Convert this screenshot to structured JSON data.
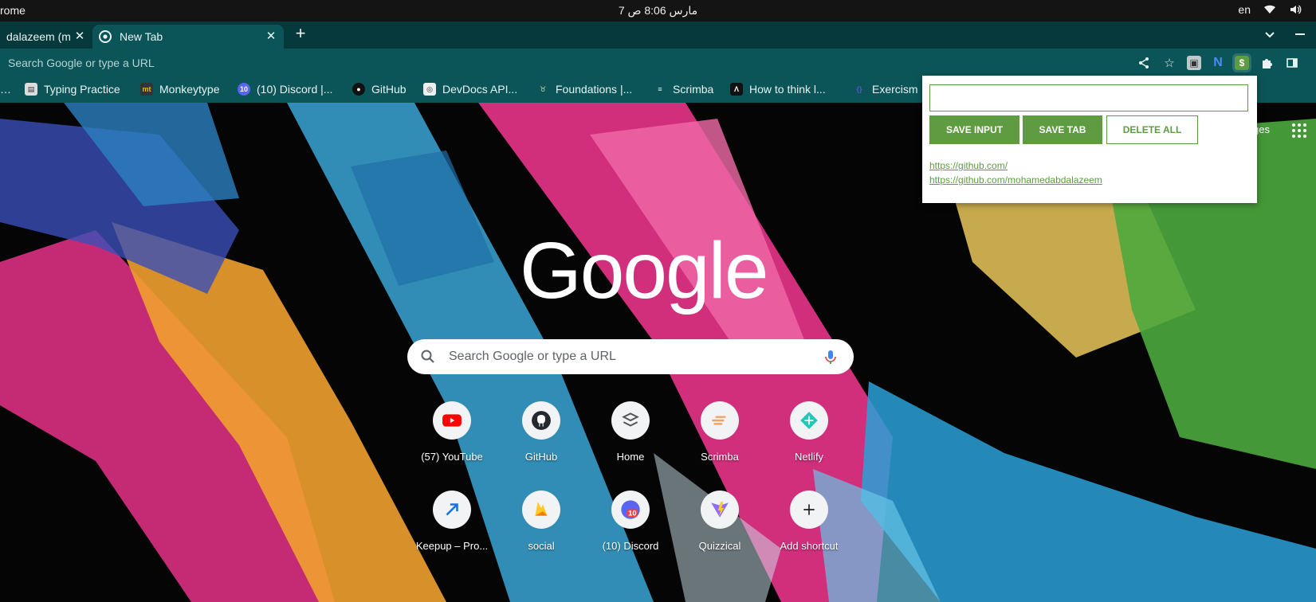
{
  "os": {
    "app_name": "rome",
    "clock": "7 مارس  8:06 ص",
    "lang": "en"
  },
  "tabs": [
    {
      "title": "dalazeem (m",
      "active": false
    },
    {
      "title": "New Tab",
      "active": true
    }
  ],
  "omnibox": {
    "placeholder": "Search Google or type a URL"
  },
  "bookmarks": [
    {
      "label": "Typing Practice",
      "icon": "typing-icon"
    },
    {
      "label": "Monkeytype",
      "icon": "monkeytype-icon"
    },
    {
      "label": "(10) Discord |...",
      "icon": "discord-icon"
    },
    {
      "label": "GitHub",
      "icon": "github-icon"
    },
    {
      "label": "DevDocs API...",
      "icon": "devdocs-icon"
    },
    {
      "label": "Foundations |...",
      "icon": "odin-icon"
    },
    {
      "label": "Scrimba",
      "icon": "scrimba-icon"
    },
    {
      "label": "How to think l...",
      "icon": "book-icon"
    },
    {
      "label": "Exercism",
      "icon": "exercism-icon"
    }
  ],
  "ntp": {
    "top_link": "ges",
    "logo": "Google",
    "search_placeholder": "Search Google or type a URL",
    "shortcuts": [
      {
        "label": "(57) YouTube",
        "icon": "youtube-icon"
      },
      {
        "label": "GitHub",
        "icon": "github-icon"
      },
      {
        "label": "Home",
        "icon": "home-icon"
      },
      {
        "label": "Scrimba",
        "icon": "scrimba-icon"
      },
      {
        "label": "Netlify",
        "icon": "netlify-icon"
      },
      {
        "label": "Keepup – Pro...",
        "icon": "keepup-icon"
      },
      {
        "label": "social",
        "icon": "firebase-icon"
      },
      {
        "label": "(10) Discord",
        "icon": "discord-icon"
      },
      {
        "label": "Quizzical",
        "icon": "vite-icon"
      },
      {
        "label": "Add shortcut",
        "icon": "plus-icon"
      }
    ]
  },
  "popup": {
    "input_value": "",
    "save_input": "SAVE INPUT",
    "save_tab": "SAVE TAB",
    "delete_all": "DELETE ALL",
    "links": [
      "https://github.com/",
      "https://github.com/mohamedabdalazeem"
    ],
    "accent": "#5f9b41"
  },
  "theme": {
    "frame": "#05393b",
    "toolbar": "#0b5558"
  }
}
